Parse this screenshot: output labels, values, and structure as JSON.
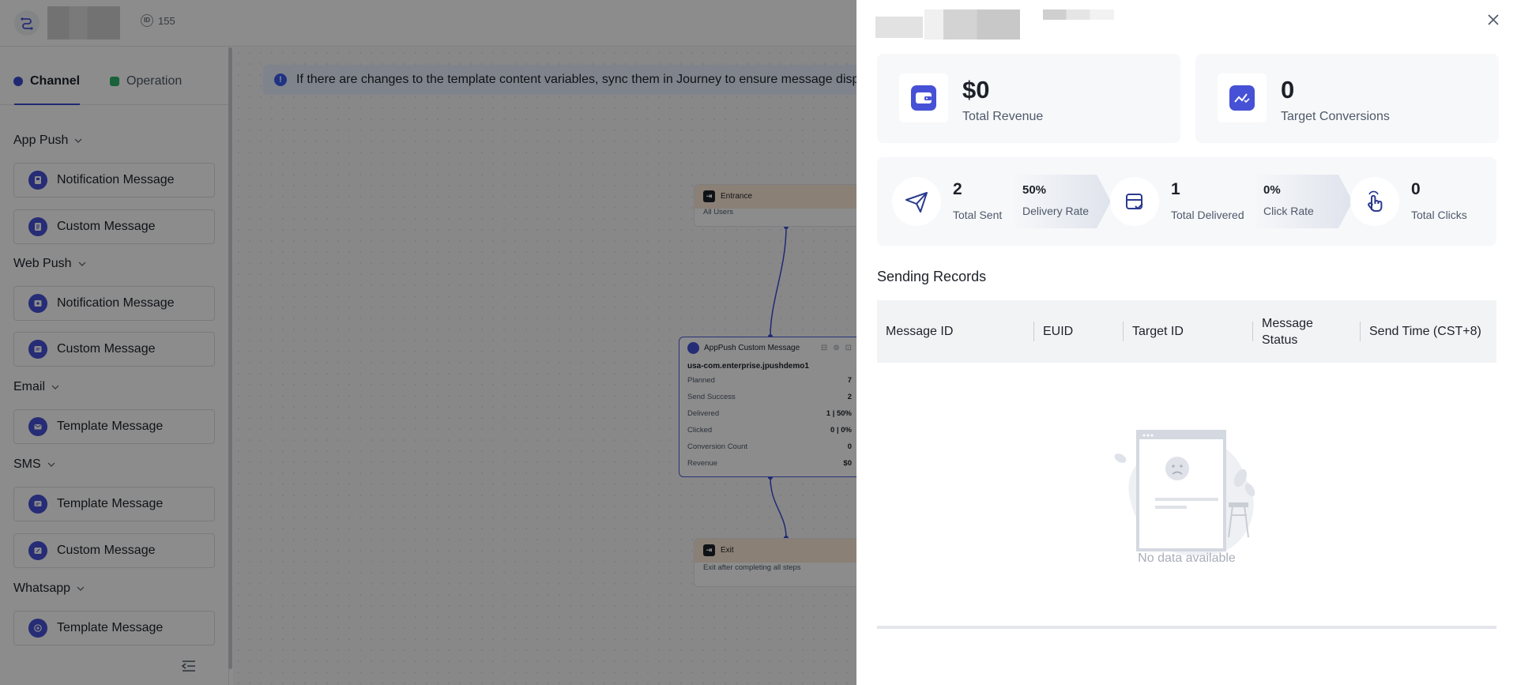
{
  "header": {
    "id_value": "155"
  },
  "sidebar": {
    "tabs": [
      {
        "label": "Channel",
        "color": "#3a4ccf"
      },
      {
        "label": "Operation",
        "color": "#2fb36b"
      }
    ],
    "groups": [
      {
        "title": "App Push",
        "items": [
          "Notification Message",
          "Custom Message"
        ]
      },
      {
        "title": "Web Push",
        "items": [
          "Notification Message",
          "Custom Message"
        ]
      },
      {
        "title": "Email",
        "items": [
          "Template Message"
        ]
      },
      {
        "title": "SMS",
        "items": [
          "Template Message",
          "Custom Message"
        ]
      },
      {
        "title": "Whatsapp",
        "items": [
          "Template Message"
        ]
      }
    ]
  },
  "canvas": {
    "notice": "If there are changes to the template content variables, sync them in Journey to ensure message display",
    "entrance": {
      "title": "Entrance",
      "subtitle": "All Users"
    },
    "message_node": {
      "title": "AppPush Custom Message",
      "app": "usa-com.enterprise.jpushdemo1",
      "stats": [
        {
          "label": "Planned",
          "value": "7"
        },
        {
          "label": "Send Success",
          "value": "2"
        },
        {
          "label": "Delivered",
          "value": "1 | 50%"
        },
        {
          "label": "Clicked",
          "value": "0 | 0%"
        },
        {
          "label": "Conversion Count",
          "value": "0"
        },
        {
          "label": "Revenue",
          "value": "$0"
        }
      ]
    },
    "exit": {
      "title": "Exit",
      "subtitle": "Exit after completing all steps"
    }
  },
  "drawer": {
    "kpis": [
      {
        "value": "$0",
        "label": "Total Revenue",
        "icon": "wallet-icon"
      },
      {
        "value": "0",
        "label": "Target Conversions",
        "icon": "trend-chart-icon"
      }
    ],
    "funnel": {
      "sent": {
        "value": "2",
        "label": "Total Sent"
      },
      "delivery_rate": {
        "value": "50%",
        "label": "Delivery Rate"
      },
      "delivered": {
        "value": "1",
        "label": "Total Delivered"
      },
      "click_rate": {
        "value": "0%",
        "label": "Click Rate"
      },
      "clicks": {
        "value": "0",
        "label": "Total Clicks"
      }
    },
    "records_title": "Sending Records",
    "table_columns": [
      "Message ID",
      "EUID",
      "Target ID",
      "Message Status",
      "Send Time (CST+8)"
    ],
    "empty_text": "No data available"
  },
  "colors": {
    "accent": "#4651d6",
    "overlay": "rgba(0,0,0,0.45)"
  }
}
